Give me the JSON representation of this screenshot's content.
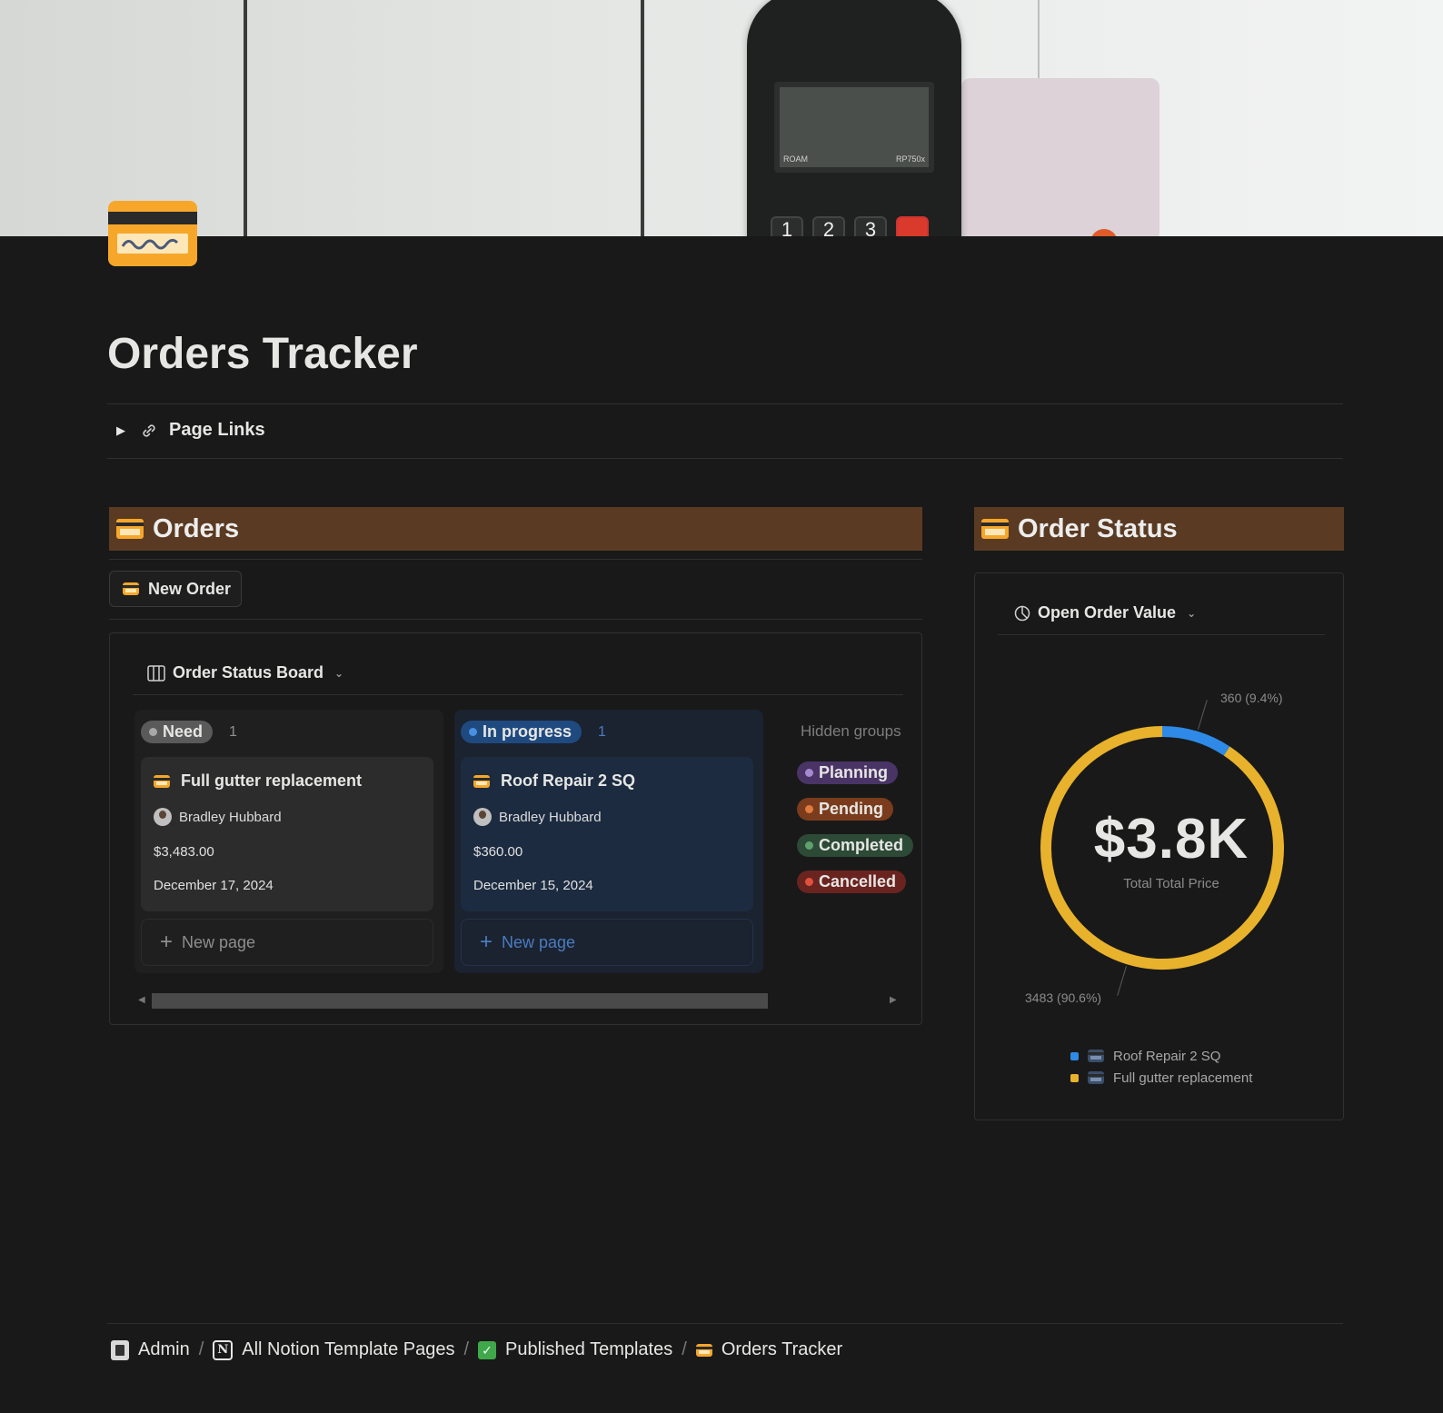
{
  "cover": {
    "terminal_brand": "ROAM",
    "terminal_model": "RP750x",
    "keys": [
      "1",
      "2",
      "3"
    ]
  },
  "page": {
    "title": "Orders Tracker",
    "toggle_label": "Page Links"
  },
  "orders": {
    "heading": "Orders",
    "new_button": "New Order",
    "view_name": "Order Status Board",
    "columns": [
      {
        "status": "Need",
        "count": "1",
        "color": "#5a5a5a",
        "dot": "#a8a8a8",
        "card": {
          "title": "Full gutter replacement",
          "person": "Bradley Hubbard",
          "price": "$3,483.00",
          "date": "December 17, 2024"
        },
        "new_page": "New page"
      },
      {
        "status": "In progress",
        "count": "1",
        "color": "#1f4a80",
        "dot": "#4a90e2",
        "card": {
          "title": "Roof Repair 2 SQ",
          "person": "Bradley Hubbard",
          "price": "$360.00",
          "date": "December 15, 2024"
        },
        "new_page": "New page"
      }
    ],
    "hidden_groups_label": "Hidden groups",
    "hidden_groups": [
      {
        "label": "Planning",
        "bg": "#4a3466",
        "dot": "#a58ad0"
      },
      {
        "label": "Pending",
        "bg": "#7a3c1c",
        "dot": "#e07a3c"
      },
      {
        "label": "Completed",
        "bg": "#2c4a36",
        "dot": "#5fa06e"
      },
      {
        "label": "Cancelled",
        "bg": "#6a2420",
        "dot": "#e0503c"
      }
    ]
  },
  "status": {
    "heading": "Order Status",
    "view_name": "Open Order Value",
    "center_value": "$3.8K",
    "center_label": "Total Total Price"
  },
  "chart_data": {
    "type": "pie",
    "title": "",
    "total_label": "Total Total Price",
    "total_value": "$3.8K",
    "series": [
      {
        "name": "Roof Repair 2 SQ",
        "value": 360,
        "percent": 9.4,
        "label": "360 (9.4%)",
        "color": "#2e8ae6"
      },
      {
        "name": "Full gutter replacement",
        "value": 3483,
        "percent": 90.6,
        "label": "3483 (90.6%)",
        "color": "#e8b22c"
      }
    ],
    "legend_position": "bottom"
  },
  "breadcrumbs": [
    "Admin",
    "All Notion Template Pages",
    "Published Templates",
    "Orders Tracker"
  ],
  "breadcrumb_sep": "/"
}
